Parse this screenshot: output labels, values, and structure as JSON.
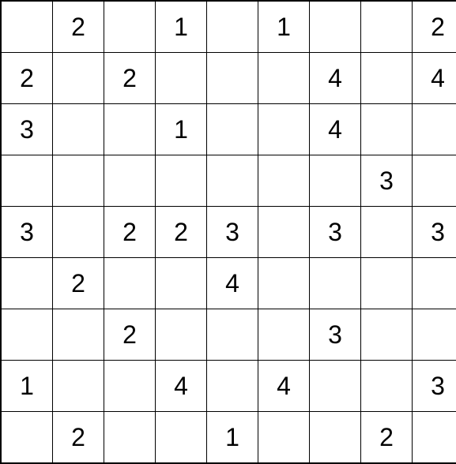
{
  "puzzle": {
    "size": 9,
    "cells": [
      [
        "",
        "2",
        "",
        "1",
        "",
        "1",
        "",
        "",
        "2"
      ],
      [
        "2",
        "",
        "2",
        "",
        "",
        "",
        "4",
        "",
        "4"
      ],
      [
        "3",
        "",
        "",
        "1",
        "",
        "",
        "4",
        "",
        ""
      ],
      [
        "",
        "",
        "",
        "",
        "",
        "",
        "",
        "3",
        ""
      ],
      [
        "3",
        "",
        "2",
        "2",
        "3",
        "",
        "3",
        "",
        "3"
      ],
      [
        "",
        "2",
        "",
        "",
        "4",
        "",
        "",
        "",
        ""
      ],
      [
        "",
        "",
        "2",
        "",
        "",
        "",
        "3",
        "",
        ""
      ],
      [
        "1",
        "",
        "",
        "4",
        "",
        "4",
        "",
        "",
        "3"
      ],
      [
        "",
        "2",
        "",
        "",
        "1",
        "",
        "",
        "2",
        ""
      ]
    ]
  }
}
